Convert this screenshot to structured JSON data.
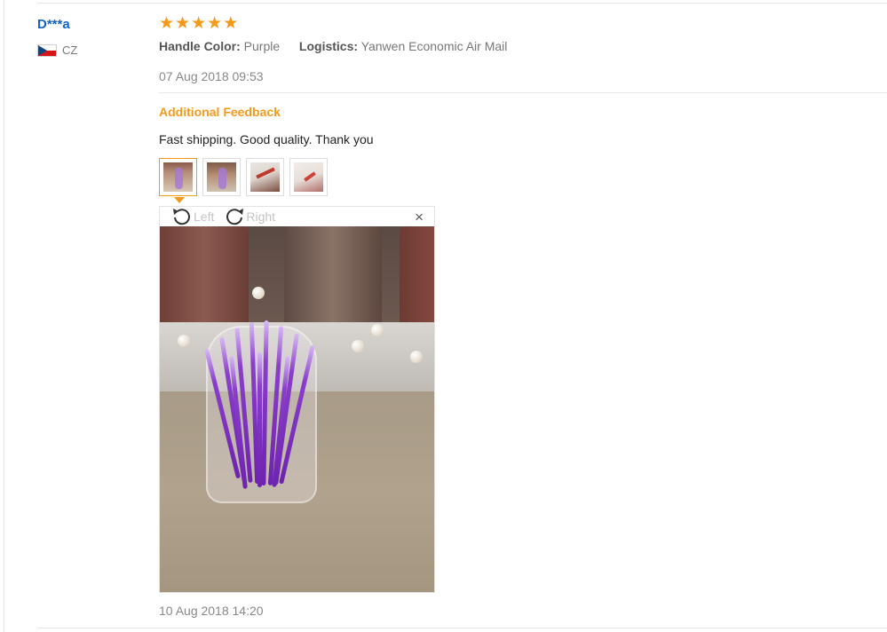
{
  "review": {
    "user_name": "D***a",
    "country_code": "CZ",
    "rating_stars": 5,
    "star_glyph": "★",
    "attributes": [
      {
        "label": "Handle Color:",
        "value": "Purple"
      },
      {
        "label": "Logistics:",
        "value": "Yanwen Economic Air Mail"
      }
    ],
    "date": "07 Aug 2018 09:53"
  },
  "additional_feedback": {
    "title": "Additional Feedback",
    "text": "Fast shipping. Good quality. Thank you",
    "thumbnails": [
      "thumb-1",
      "thumb-2",
      "thumb-3",
      "thumb-4"
    ],
    "active_thumbnail": 0,
    "viewer": {
      "rotate_left_label": "Left",
      "rotate_right_label": "Right",
      "close_glyph": "×"
    },
    "date": "10 Aug 2018 14:20"
  },
  "colors": {
    "accent": "#f49a1b",
    "username": "#0f64c8"
  }
}
